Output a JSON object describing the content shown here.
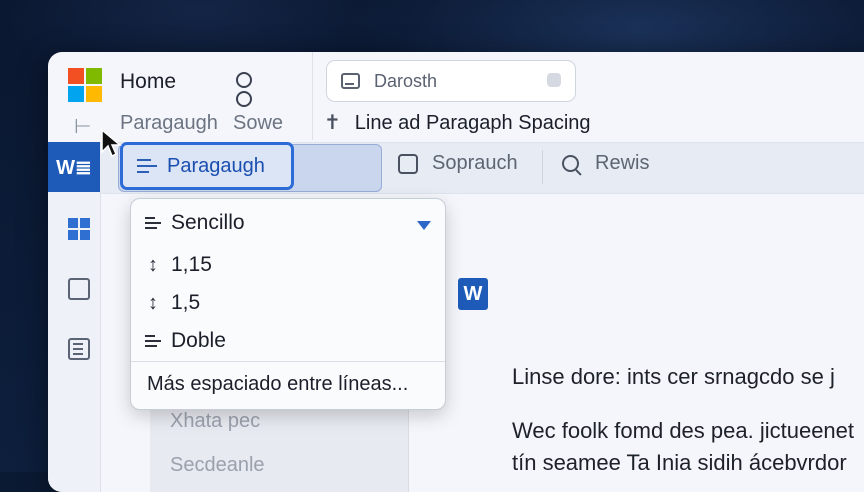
{
  "header": {
    "app_title": "Home",
    "search_text": "Darosth",
    "tab_paragraph": "Paragaugh",
    "tab_sowe": "Sowe",
    "document_title": "Line ad Paragaph Spacing"
  },
  "ribbon": {
    "paragraph_button": "Paragaugh",
    "sopr_label": "Soprаuch",
    "revis_label": "Rewis"
  },
  "colors": {
    "accent": "#2d6bd6",
    "word_blue": "#1e5bb8",
    "ms_red": "#f25022",
    "ms_green": "#7fba00",
    "ms_blue": "#00a4ef",
    "ms_yellow": "#ffb900"
  },
  "dropdown": {
    "items": [
      {
        "label": "Sencillo",
        "icon": "lines-icon"
      },
      {
        "label": "1,15",
        "icon": "vertical-arrows-icon"
      },
      {
        "label": "1,5",
        "icon": "vertical-arrows-icon"
      },
      {
        "label": "Doble",
        "icon": "lines-icon"
      }
    ],
    "more_label": "Más espaciado entre líneas..."
  },
  "side_pane": {
    "items": [
      "Xhata pec",
      "Secdeanle"
    ]
  },
  "document": {
    "lines": [
      "Linse dore: ints cer srnagcdo se j",
      "Wec foolk fomd des pea. jictueenet",
      "tín seamee Ta Inia sidih ácebvrdor"
    ]
  }
}
